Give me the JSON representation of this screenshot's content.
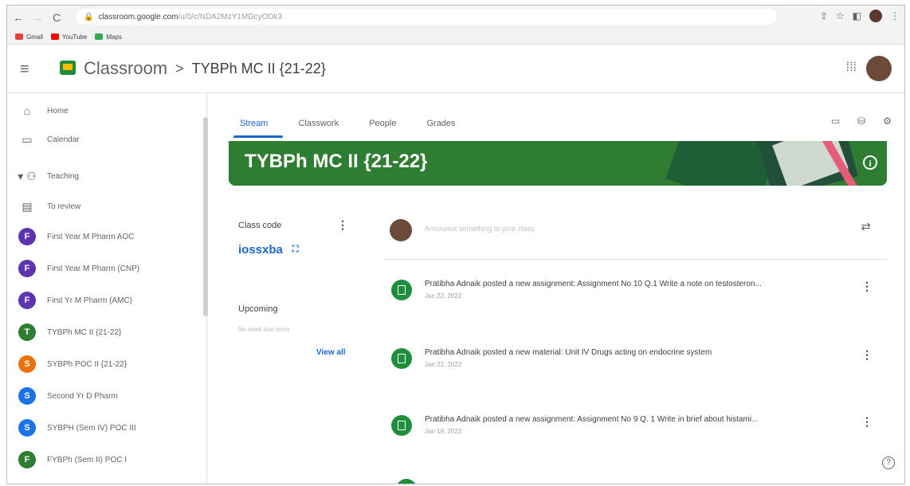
{
  "browser": {
    "url_host": "classroom.google.com",
    "url_path": "/u/0/c/NDA2MzY1MDcyODk3",
    "bookmarks": [
      "Gmail",
      "YouTube",
      "Maps"
    ]
  },
  "header": {
    "app": "Classroom",
    "separator": ">",
    "class_name": "TYBPh MC II {21-22}"
  },
  "sidebar": {
    "items": [
      {
        "label": "Home",
        "icon": "home-icon"
      },
      {
        "label": "Calendar",
        "icon": "calendar-icon"
      },
      {
        "label": "Teaching",
        "icon": "teaching-icon"
      },
      {
        "label": "To review",
        "icon": "review-icon"
      }
    ],
    "classes": [
      {
        "letter": "F",
        "label": "First Year M Pharm AOC",
        "color": "#5e35b1"
      },
      {
        "letter": "F",
        "label": "First Year M Pharm (CNP)",
        "color": "#5e35b1"
      },
      {
        "letter": "F",
        "label": "First Yr M Pharm (AMC)",
        "color": "#5e35b1"
      },
      {
        "letter": "T",
        "label": "TYBPh MC II {21-22}",
        "color": "#2e7d32"
      },
      {
        "letter": "S",
        "label": "SYBPh POC II {21-22}",
        "color": "#e8710a"
      },
      {
        "letter": "S",
        "label": "Second Yr D Pharm",
        "color": "#1a73e8"
      },
      {
        "letter": "S",
        "label": "SYBPH (Sem IV) POC III",
        "color": "#1a73e8"
      },
      {
        "letter": "F",
        "label": "FYBPh (Sem II) POC I",
        "color": "#2e7d32"
      }
    ]
  },
  "tabs": [
    "Stream",
    "Classwork",
    "People",
    "Grades"
  ],
  "banner": {
    "title": "TYBPh MC II {21-22}"
  },
  "class_code": {
    "label": "Class code",
    "value": "iossxba"
  },
  "upcoming": {
    "label": "Upcoming",
    "empty_text": "No work due soon",
    "view_all": "View all"
  },
  "announce": {
    "placeholder": "Announce something to your class"
  },
  "posts": [
    {
      "text": "Pratibha Adnaik posted a new assignment: Assignment No 10 Q.1 Write a note on testosteron...",
      "date": "Jan 22, 2022"
    },
    {
      "text": "Pratibha Adnaik posted a new material: Unit IV Drugs acting on endocrine system",
      "date": "Jan 22, 2022"
    },
    {
      "text": "Pratibha Adnaik posted a new assignment: Assignment No 9 Q. 1 Write in brief about histami...",
      "date": "Jan 19, 2022"
    }
  ],
  "colors": {
    "accent": "#1967d2",
    "banner": "#2e7d32"
  }
}
